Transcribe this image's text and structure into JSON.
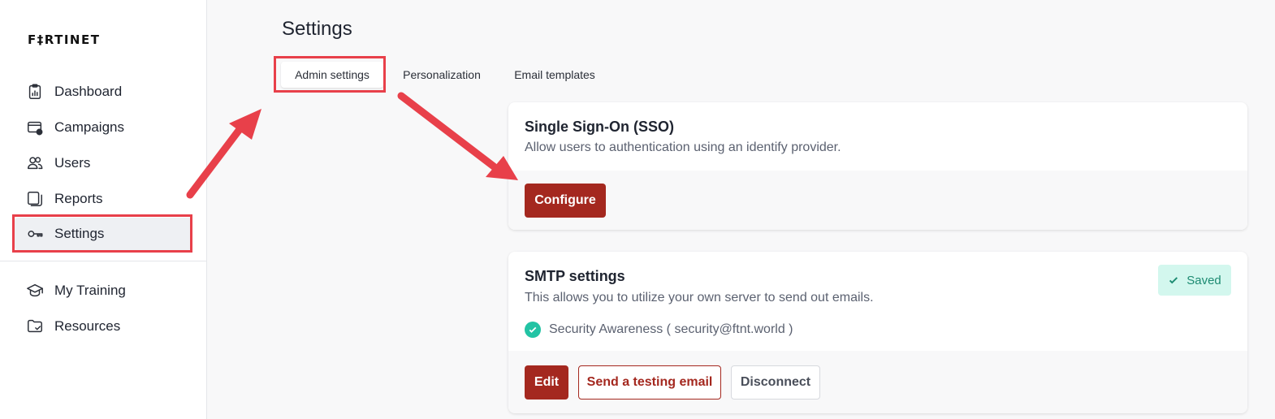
{
  "app": {
    "logo_text": "F‡RTINET"
  },
  "sidebar": {
    "items": [
      {
        "label": "Dashboard",
        "icon": "dashboard-icon"
      },
      {
        "label": "Campaigns",
        "icon": "campaigns-icon"
      },
      {
        "label": "Users",
        "icon": "users-icon"
      },
      {
        "label": "Reports",
        "icon": "reports-icon"
      },
      {
        "label": "Settings",
        "icon": "settings-key-icon"
      },
      {
        "label": "My Training",
        "icon": "graduation-cap-icon"
      },
      {
        "label": "Resources",
        "icon": "folder-icon"
      }
    ]
  },
  "main": {
    "title": "Settings",
    "tabs": [
      {
        "label": "Admin settings"
      },
      {
        "label": "Personalization"
      },
      {
        "label": "Email templates"
      }
    ],
    "sso": {
      "title": "Single Sign-On (SSO)",
      "description": "Allow users to authentication using an identify provider.",
      "configure_label": "Configure"
    },
    "smtp": {
      "title": "SMTP settings",
      "description": "This allows you to utilize your own server to send out emails.",
      "status_badge": "Saved",
      "server": "Security Awareness ( security@ftnt.world )",
      "edit_label": "Edit",
      "test_label": "Send a testing email",
      "disconnect_label": "Disconnect"
    }
  },
  "colors": {
    "primary": "#a4281f",
    "annotation": "#e8404a",
    "success": "#22c3a4"
  }
}
